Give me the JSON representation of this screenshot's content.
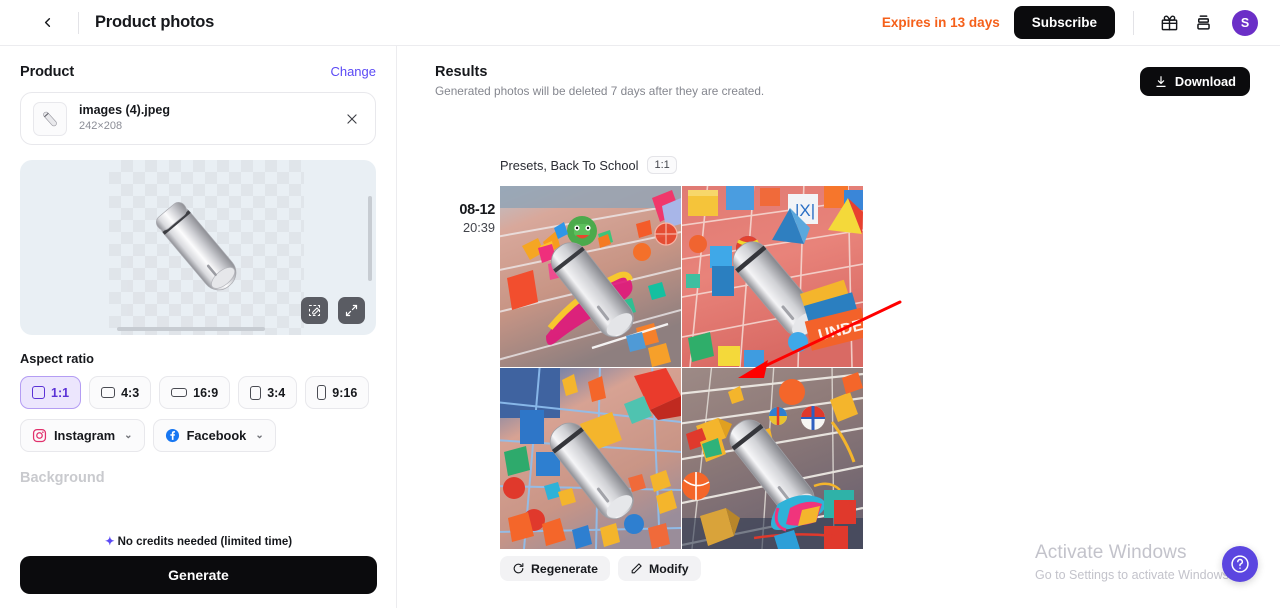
{
  "header": {
    "back_icon": "chevron-left-icon",
    "title": "Product photos",
    "expires_text": "Expires in 13 days",
    "subscribe_label": "Subscribe",
    "gift_icon": "gift-icon",
    "stack_icon": "stack-icon",
    "avatar_initial": "S",
    "expires_color": "#f5601a",
    "avatar_color": "#6b2fc7"
  },
  "left_panel": {
    "product_label": "Product",
    "change_label": "Change",
    "file": {
      "name": "images (4).jpeg",
      "dimensions": "242×208",
      "thumb_icon": "bottle-thumbnail",
      "close_icon": "close-icon"
    },
    "canvas": {
      "erase_icon": "magic-eraser-icon",
      "expand_icon": "expand-icon"
    },
    "aspect_ratio_label": "Aspect ratio",
    "aspect_ratios": [
      {
        "label": "1:1",
        "selected": true,
        "w": 13,
        "h": 13
      },
      {
        "label": "4:3",
        "selected": false,
        "w": 14,
        "h": 11
      },
      {
        "label": "16:9",
        "selected": false,
        "w": 16,
        "h": 9
      },
      {
        "label": "3:4",
        "selected": false,
        "w": 11,
        "h": 14
      },
      {
        "label": "9:16",
        "selected": false,
        "w": 9,
        "h": 15
      }
    ],
    "social": [
      {
        "label": "Instagram",
        "icon": "instagram-icon",
        "chevron": "⌄"
      },
      {
        "label": "Facebook",
        "icon": "facebook-icon",
        "chevron": "⌄"
      }
    ],
    "background_label": "Background",
    "credits_text": "No credits needed (limited time)",
    "credits_spark": "✦",
    "generate_label": "Generate",
    "selected_accent": "#5b32d6"
  },
  "right_panel": {
    "results_title": "Results",
    "results_subtitle": "Generated photos will be deleted 7 days after they are created.",
    "download_label": "Download",
    "download_icon": "download-icon",
    "result": {
      "date": "08-12",
      "time": "20:39",
      "caption": "Presets, Back To School",
      "ratio_badge": "1:1",
      "images": [
        {
          "alt": "generated-photo-1"
        },
        {
          "alt": "generated-photo-2"
        },
        {
          "alt": "generated-photo-3"
        },
        {
          "alt": "generated-photo-4"
        }
      ],
      "regenerate_label": "Regenerate",
      "regenerate_icon": "refresh-icon",
      "modify_label": "Modify",
      "modify_icon": "pencil-icon",
      "annotation_arrow": "red-arrow-annotation"
    }
  },
  "watermark": {
    "title": "Activate Windows",
    "subtitle": "Go to Settings to activate Windows."
  },
  "help": {
    "icon": "question-mark-icon"
  }
}
